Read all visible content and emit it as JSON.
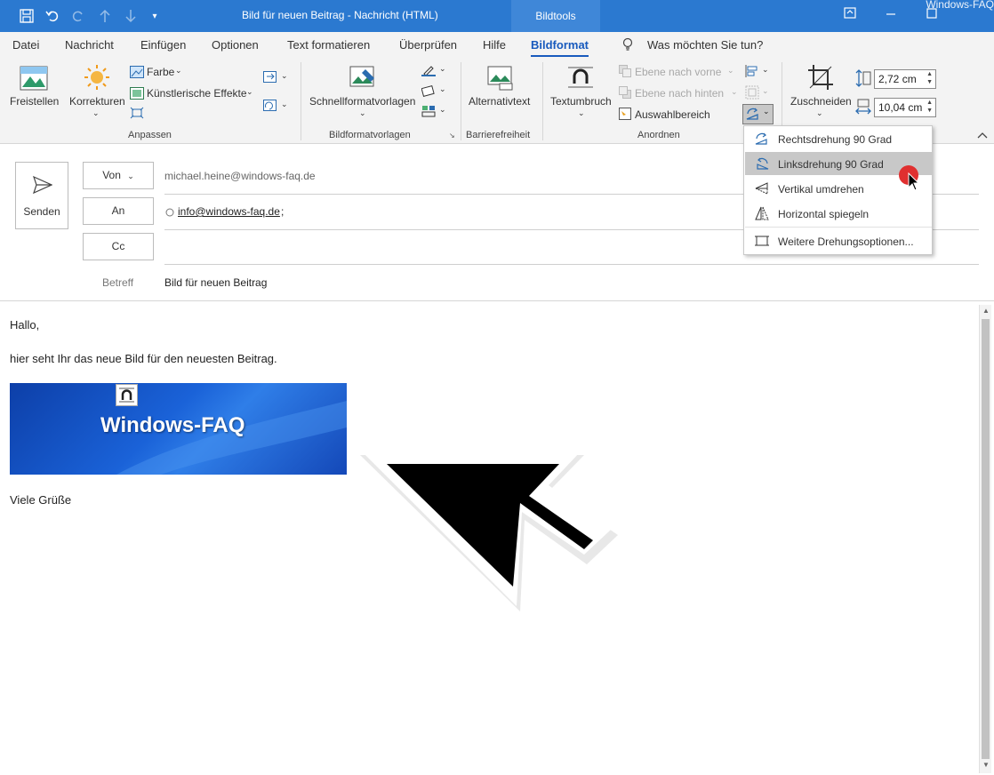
{
  "titlebar": {
    "title": "Bild für neuen Beitrag  -  Nachricht (HTML)",
    "context_tab": "Bildtools",
    "watermark": "Windows-FAQ"
  },
  "tabs": [
    "Datei",
    "Nachricht",
    "Einfügen",
    "Optionen",
    "Text formatieren",
    "Überprüfen",
    "Hilfe",
    "Bildformat"
  ],
  "tell_me": "Was möchten Sie tun?",
  "ribbon": {
    "freistellen": "Freistellen",
    "korrekturen": "Korrekturen",
    "farbe": "Farbe",
    "kuenstlerische": "Künstlerische Effekte",
    "anpassen": "Anpassen",
    "schnellformat": "Schnellformatvorlagen",
    "bildformatvorlagen": "Bildformatvorlagen",
    "alternativtext": "Alternativtext",
    "barrierefreiheit": "Barrierefreiheit",
    "textumbruch": "Textumbruch",
    "ebene_vorne": "Ebene nach vorne",
    "ebene_hinten": "Ebene nach hinten",
    "auswahlbereich": "Auswahlbereich",
    "anordnen": "Anordnen",
    "zuschneiden": "Zuschneiden",
    "height": "2,72 cm",
    "width": "10,04 cm"
  },
  "menu": {
    "items": [
      {
        "label": "Rechtsdrehung 90 Grad"
      },
      {
        "label": "Linksdrehung 90 Grad"
      },
      {
        "label": "Vertikal umdrehen"
      },
      {
        "label": "Horizontal spiegeln"
      },
      {
        "label": "Weitere Drehungsoptionen..."
      }
    ]
  },
  "compose": {
    "send": "Senden",
    "from_btn": "Von",
    "from_value": "michael.heine@windows-faq.de",
    "to_btn": "An",
    "to_value": "info@windows-faq.de",
    "to_sep": ";",
    "cc_btn": "Cc",
    "subject_label": "Betreff",
    "subject_value": "Bild für neuen Beitrag"
  },
  "body": {
    "line1": "Hallo,",
    "line2": "hier seht Ihr das neue Bild für den neuesten Beitrag.",
    "banner_text": "Windows-FAQ",
    "line3": "Viele Grüße"
  },
  "colors": {
    "accent": "#2b79d0",
    "active_tab": "#185abd",
    "cursor_dot": "#e03030"
  }
}
